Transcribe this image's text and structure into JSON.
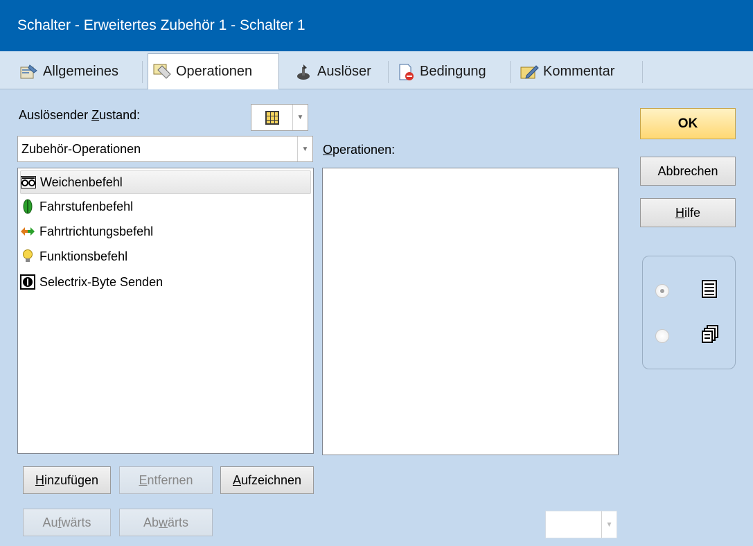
{
  "window": {
    "title": "Schalter - Erweitertes Zubehör 1 - Schalter 1"
  },
  "tabs": [
    {
      "label": "Allgemeines",
      "icon": "properties-icon"
    },
    {
      "label": "Operationen",
      "icon": "operations-icon",
      "active": true
    },
    {
      "label": "Auslöser",
      "icon": "trigger-icon"
    },
    {
      "label": "Bedingung",
      "icon": "condition-icon"
    },
    {
      "label": "Kommentar",
      "icon": "comment-icon"
    }
  ],
  "left": {
    "state_label_pre": "Auslösender ",
    "state_label_key": "Z",
    "state_label_post": "ustand:",
    "category_value": "Zubehör-Operationen",
    "items": [
      {
        "label": "Weichenbefehl",
        "icon": "turnout-icon",
        "selected": true
      },
      {
        "label": "Fahrstufenbefehl",
        "icon": "speed-step-icon"
      },
      {
        "label": "Fahrtrichtungsbefehl",
        "icon": "direction-icon"
      },
      {
        "label": "Funktionsbefehl",
        "icon": "function-bulb-icon"
      },
      {
        "label": "Selectrix-Byte Senden",
        "icon": "selectrix-icon"
      }
    ]
  },
  "right": {
    "ops_label_key": "O",
    "ops_label_post": "perationen:"
  },
  "buttons": {
    "add_key": "H",
    "add_post": "inzufügen",
    "remove_key": "E",
    "remove_post": "ntfernen",
    "record_key": "A",
    "record_post": "ufzeichnen",
    "up_pre": "Au",
    "up_key": "f",
    "up_post": "wärts",
    "down_pre": "Ab",
    "down_key": "w",
    "down_post": "ärts",
    "ok": "OK",
    "cancel": "Abbrechen",
    "help_key": "H",
    "help_post": "ilfe"
  },
  "view_options": [
    {
      "icon": "list-view-icon",
      "checked": true
    },
    {
      "icon": "copy-view-icon",
      "checked": false
    }
  ],
  "colors": {
    "titlebar": "#0063b1",
    "body": "#c5d9ee",
    "ok": "#ffd873"
  }
}
